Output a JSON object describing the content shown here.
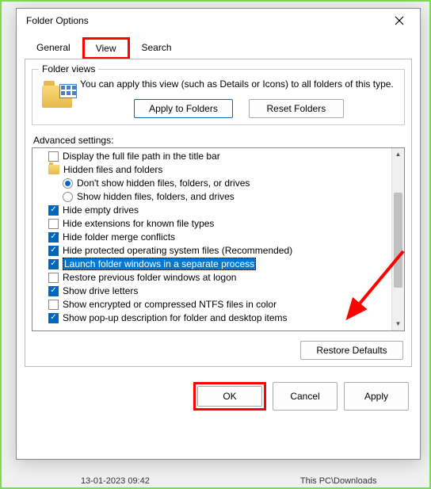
{
  "dialog": {
    "title": "Folder Options"
  },
  "tabs": {
    "general": "General",
    "view": "View",
    "search": "Search"
  },
  "folder_views": {
    "group_label": "Folder views",
    "description": "You can apply this view (such as Details or Icons) to all folders of this type.",
    "apply_btn": "Apply to Folders",
    "reset_btn": "Reset Folders"
  },
  "advanced": {
    "label": "Advanced settings:",
    "items": [
      {
        "type": "checkbox",
        "checked": false,
        "indent": 1,
        "label": "Display the full file path in the title bar"
      },
      {
        "type": "folder",
        "indent": 1,
        "label": "Hidden files and folders"
      },
      {
        "type": "radio",
        "selected": true,
        "indent": 2,
        "label": "Don't show hidden files, folders, or drives"
      },
      {
        "type": "radio",
        "selected": false,
        "indent": 2,
        "label": "Show hidden files, folders, and drives"
      },
      {
        "type": "checkbox",
        "checked": true,
        "indent": 1,
        "label": "Hide empty drives"
      },
      {
        "type": "checkbox",
        "checked": false,
        "indent": 1,
        "label": "Hide extensions for known file types"
      },
      {
        "type": "checkbox",
        "checked": true,
        "indent": 1,
        "label": "Hide folder merge conflicts"
      },
      {
        "type": "checkbox",
        "checked": true,
        "indent": 1,
        "label": "Hide protected operating system files (Recommended)"
      },
      {
        "type": "checkbox",
        "checked": true,
        "indent": 1,
        "label": "Launch folder windows in a separate process",
        "highlighted": true
      },
      {
        "type": "checkbox",
        "checked": false,
        "indent": 1,
        "label": "Restore previous folder windows at logon"
      },
      {
        "type": "checkbox",
        "checked": true,
        "indent": 1,
        "label": "Show drive letters"
      },
      {
        "type": "checkbox",
        "checked": false,
        "indent": 1,
        "label": "Show encrypted or compressed NTFS files in color"
      },
      {
        "type": "checkbox",
        "checked": true,
        "indent": 1,
        "label": "Show pop-up description for folder and desktop items"
      }
    ]
  },
  "buttons": {
    "restore_defaults": "Restore Defaults",
    "ok": "OK",
    "cancel": "Cancel",
    "apply": "Apply"
  },
  "background": {
    "date": "13-01-2023 09:42",
    "location": "This PC\\Downloads"
  }
}
